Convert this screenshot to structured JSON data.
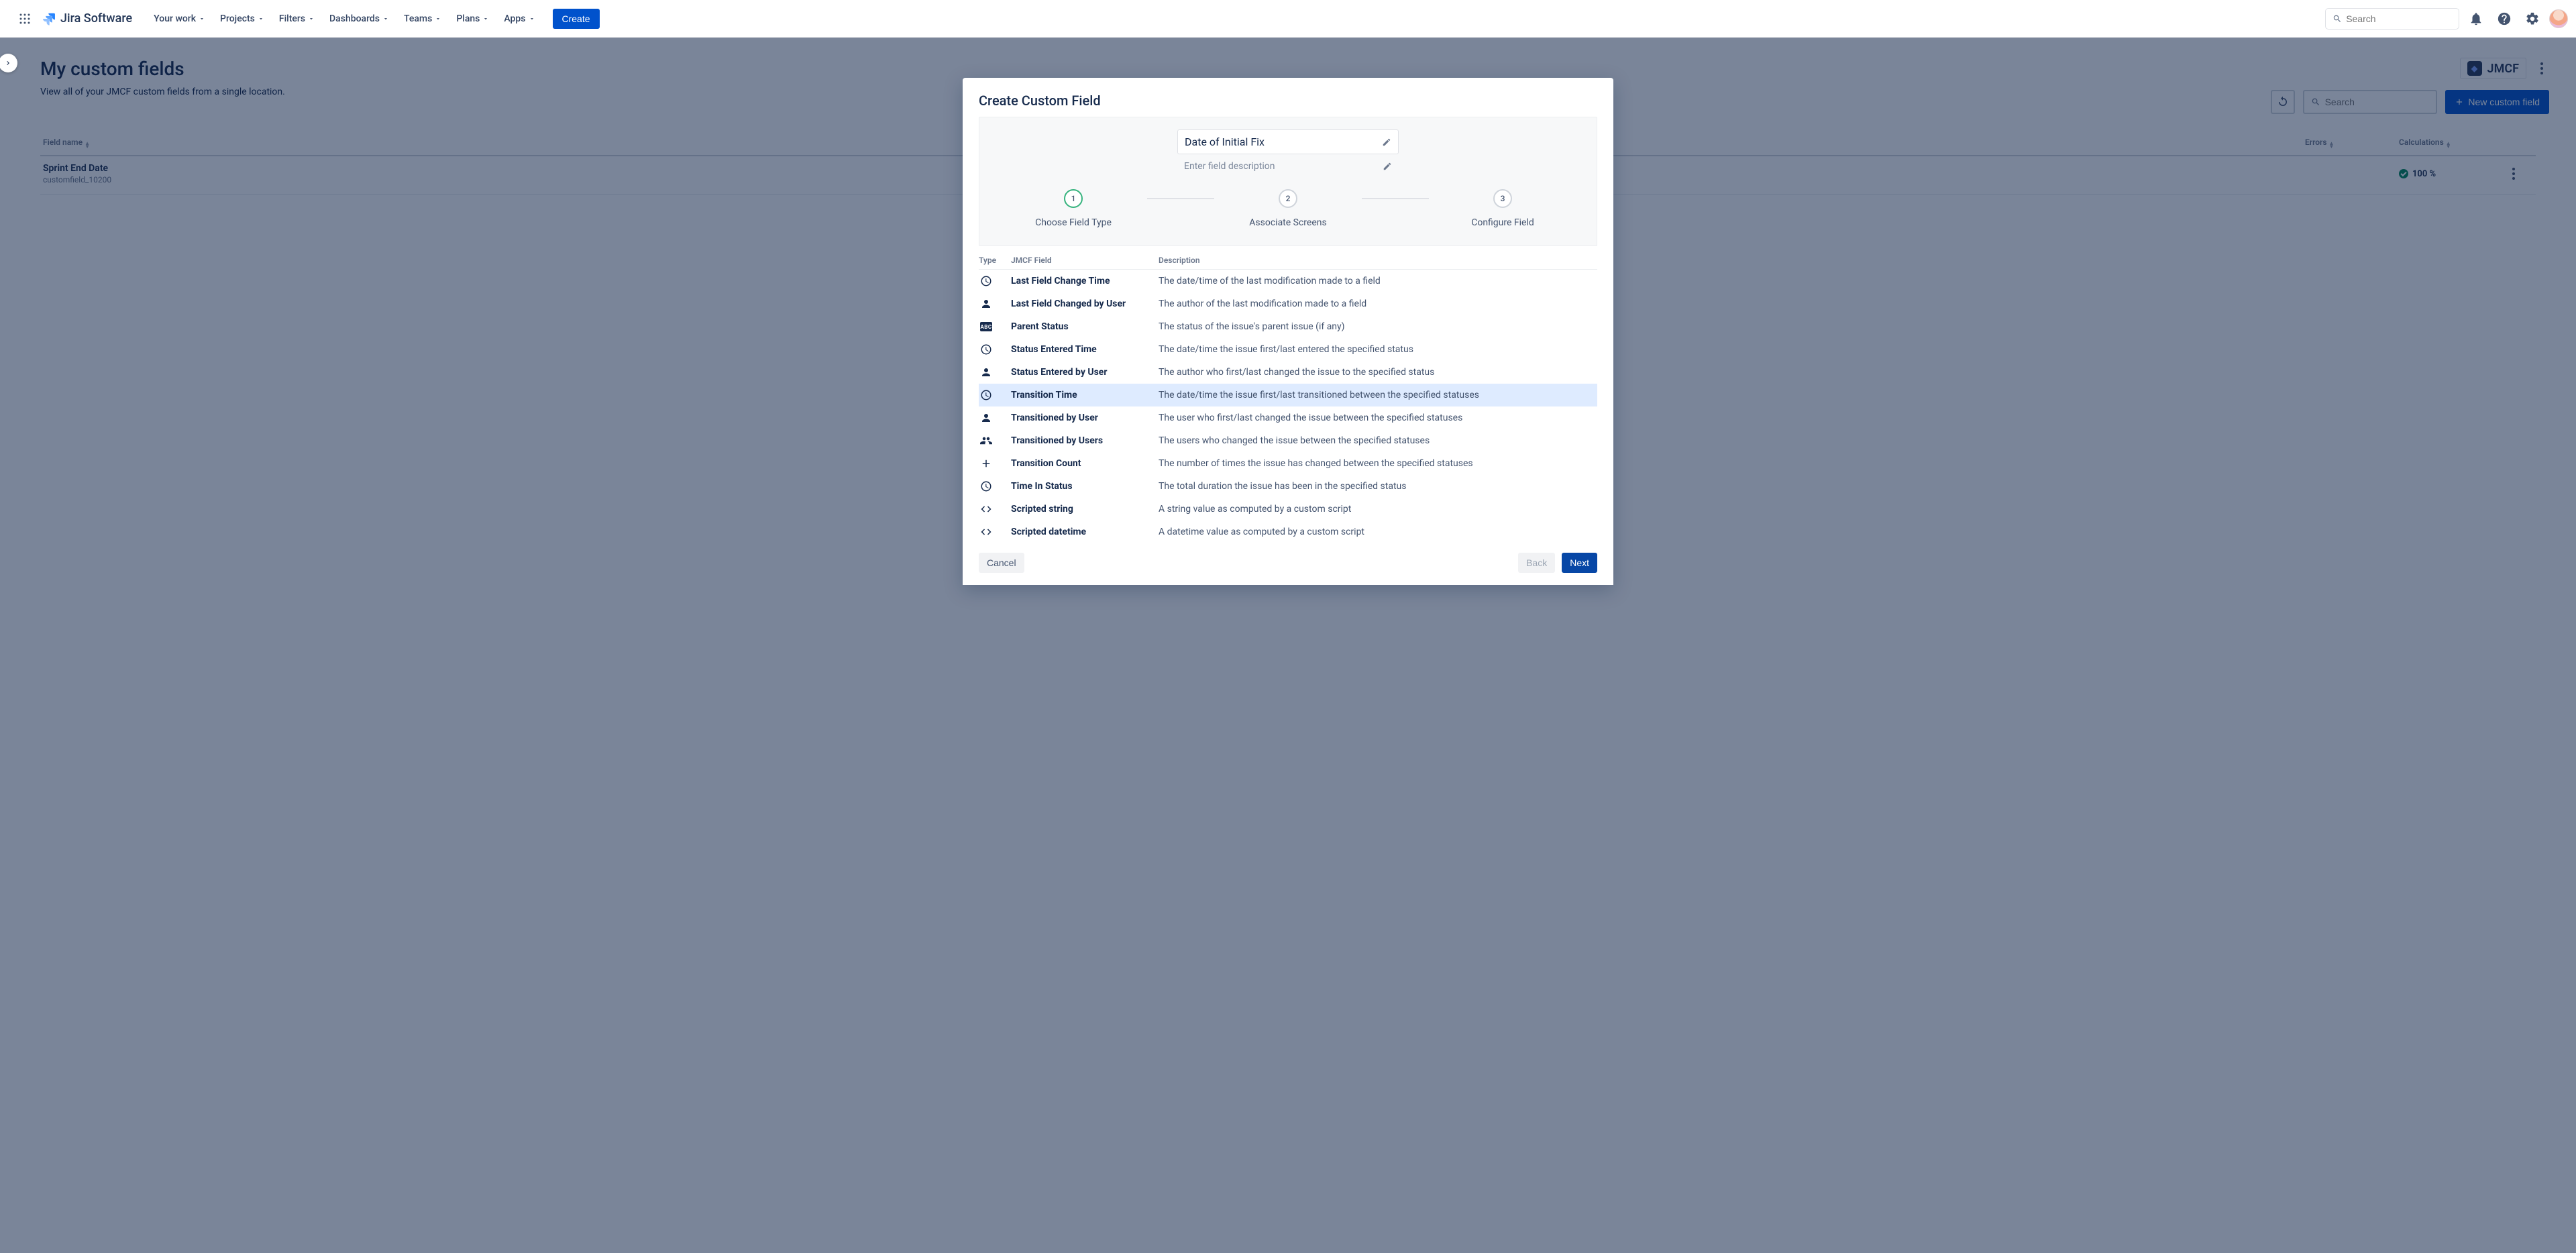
{
  "nav": {
    "product": "Jira Software",
    "items": [
      "Your work",
      "Projects",
      "Filters",
      "Dashboards",
      "Teams",
      "Plans",
      "Apps"
    ],
    "create": "Create",
    "search_placeholder": "Search"
  },
  "page": {
    "title": "My custom fields",
    "subtitle": "View all of your JMCF custom fields from a single location.",
    "badge": "JMCF",
    "search_placeholder": "Search",
    "new_button": "New custom field",
    "columns": {
      "name": "Field name",
      "errors": "Errors",
      "calc": "Calculations"
    },
    "row": {
      "name": "Sprint End Date",
      "id": "customfield_10200",
      "calc": "100 %"
    }
  },
  "modal": {
    "title": "Create Custom Field",
    "field_name": "Date of Initial Fix",
    "field_desc_placeholder": "Enter field description",
    "steps": [
      "Choose Field Type",
      "Associate Screens",
      "Configure Field"
    ],
    "list_headers": {
      "type": "Type",
      "field": "JMCF Field",
      "desc": "Description"
    },
    "fields": [
      {
        "icon": "clock",
        "name": "Last Field Change Time",
        "desc": "The date/time of the last modification made to a field"
      },
      {
        "icon": "user",
        "name": "Last Field Changed by User",
        "desc": "The author of the last modification made to a field"
      },
      {
        "icon": "abc",
        "name": "Parent Status",
        "desc": "The status of the issue's parent issue (if any)"
      },
      {
        "icon": "clock",
        "name": "Status Entered Time",
        "desc": "The date/time the issue first/last entered the specified status"
      },
      {
        "icon": "user",
        "name": "Status Entered by User",
        "desc": "The author who first/last changed the issue to the specified status"
      },
      {
        "icon": "clock",
        "name": "Transition Time",
        "desc": "The date/time the issue first/last transitioned between the specified statuses",
        "selected": true
      },
      {
        "icon": "user",
        "name": "Transitioned by User",
        "desc": "The user who first/last changed the issue between the specified statuses"
      },
      {
        "icon": "users",
        "name": "Transitioned by Users",
        "desc": "The users who changed the issue between the specified statuses"
      },
      {
        "icon": "plus",
        "name": "Transition Count",
        "desc": "The number of times the issue has changed between the specified statuses"
      },
      {
        "icon": "clock",
        "name": "Time In Status",
        "desc": "The total duration the issue has been in the specified status"
      },
      {
        "icon": "code",
        "name": "Scripted string",
        "desc": "A string value as computed by a custom script"
      },
      {
        "icon": "code",
        "name": "Scripted datetime",
        "desc": "A datetime value as computed by a custom script"
      }
    ],
    "buttons": {
      "cancel": "Cancel",
      "back": "Back",
      "next": "Next"
    }
  }
}
